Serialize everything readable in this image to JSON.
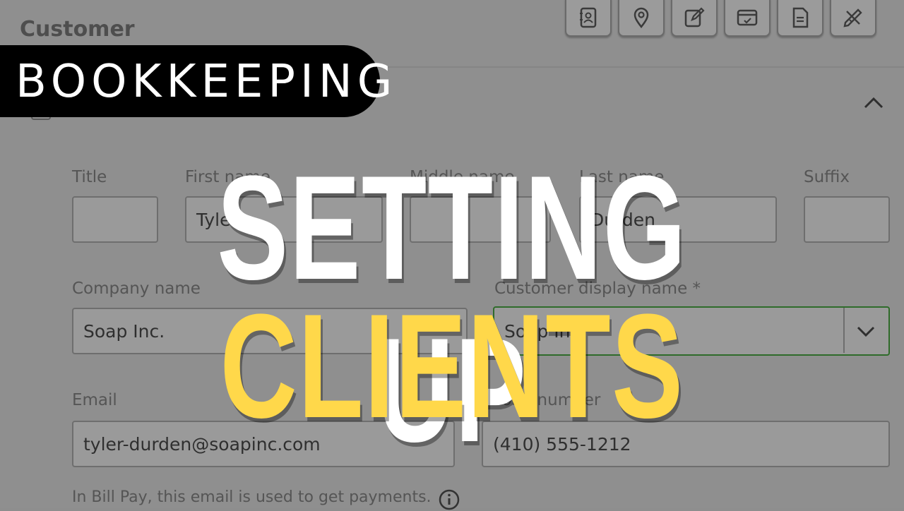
{
  "header": {
    "title": "Customer"
  },
  "toolbar": {
    "icons": [
      "address-book-icon",
      "location-pin-icon",
      "edit-icon",
      "card-check-icon",
      "document-icon",
      "tools-icon"
    ]
  },
  "overlay": {
    "tag": "BOOKKEEPING",
    "headline_line1": "SETTING UP",
    "headline_line2": "CLIENTS",
    "headline_color": "#ffd84a"
  },
  "form": {
    "title_label": "Title",
    "first_name_label": "First name",
    "middle_name_label": "Middle name",
    "last_name_label": "Last name",
    "suffix_label": "Suffix",
    "title_value": "",
    "first_name_value": "Tyler",
    "middle_name_value": "",
    "last_name_value": "Durden",
    "suffix_value": "",
    "company_label": "Company name",
    "company_value": "Soap Inc.",
    "display_name_label": "Customer display name *",
    "display_name_value": "Soap Inc.",
    "email_label": "Email",
    "email_value": "tyler-durden@soapinc.com",
    "phone_label": "Phone number",
    "phone_value": "(410) 555-1212",
    "helper_text": "In Bill Pay, this email is used to get payments."
  },
  "colors": {
    "background": "#8f8f8f",
    "focus_border": "#2f6b2a",
    "accent_yellow": "#ffd84a"
  }
}
